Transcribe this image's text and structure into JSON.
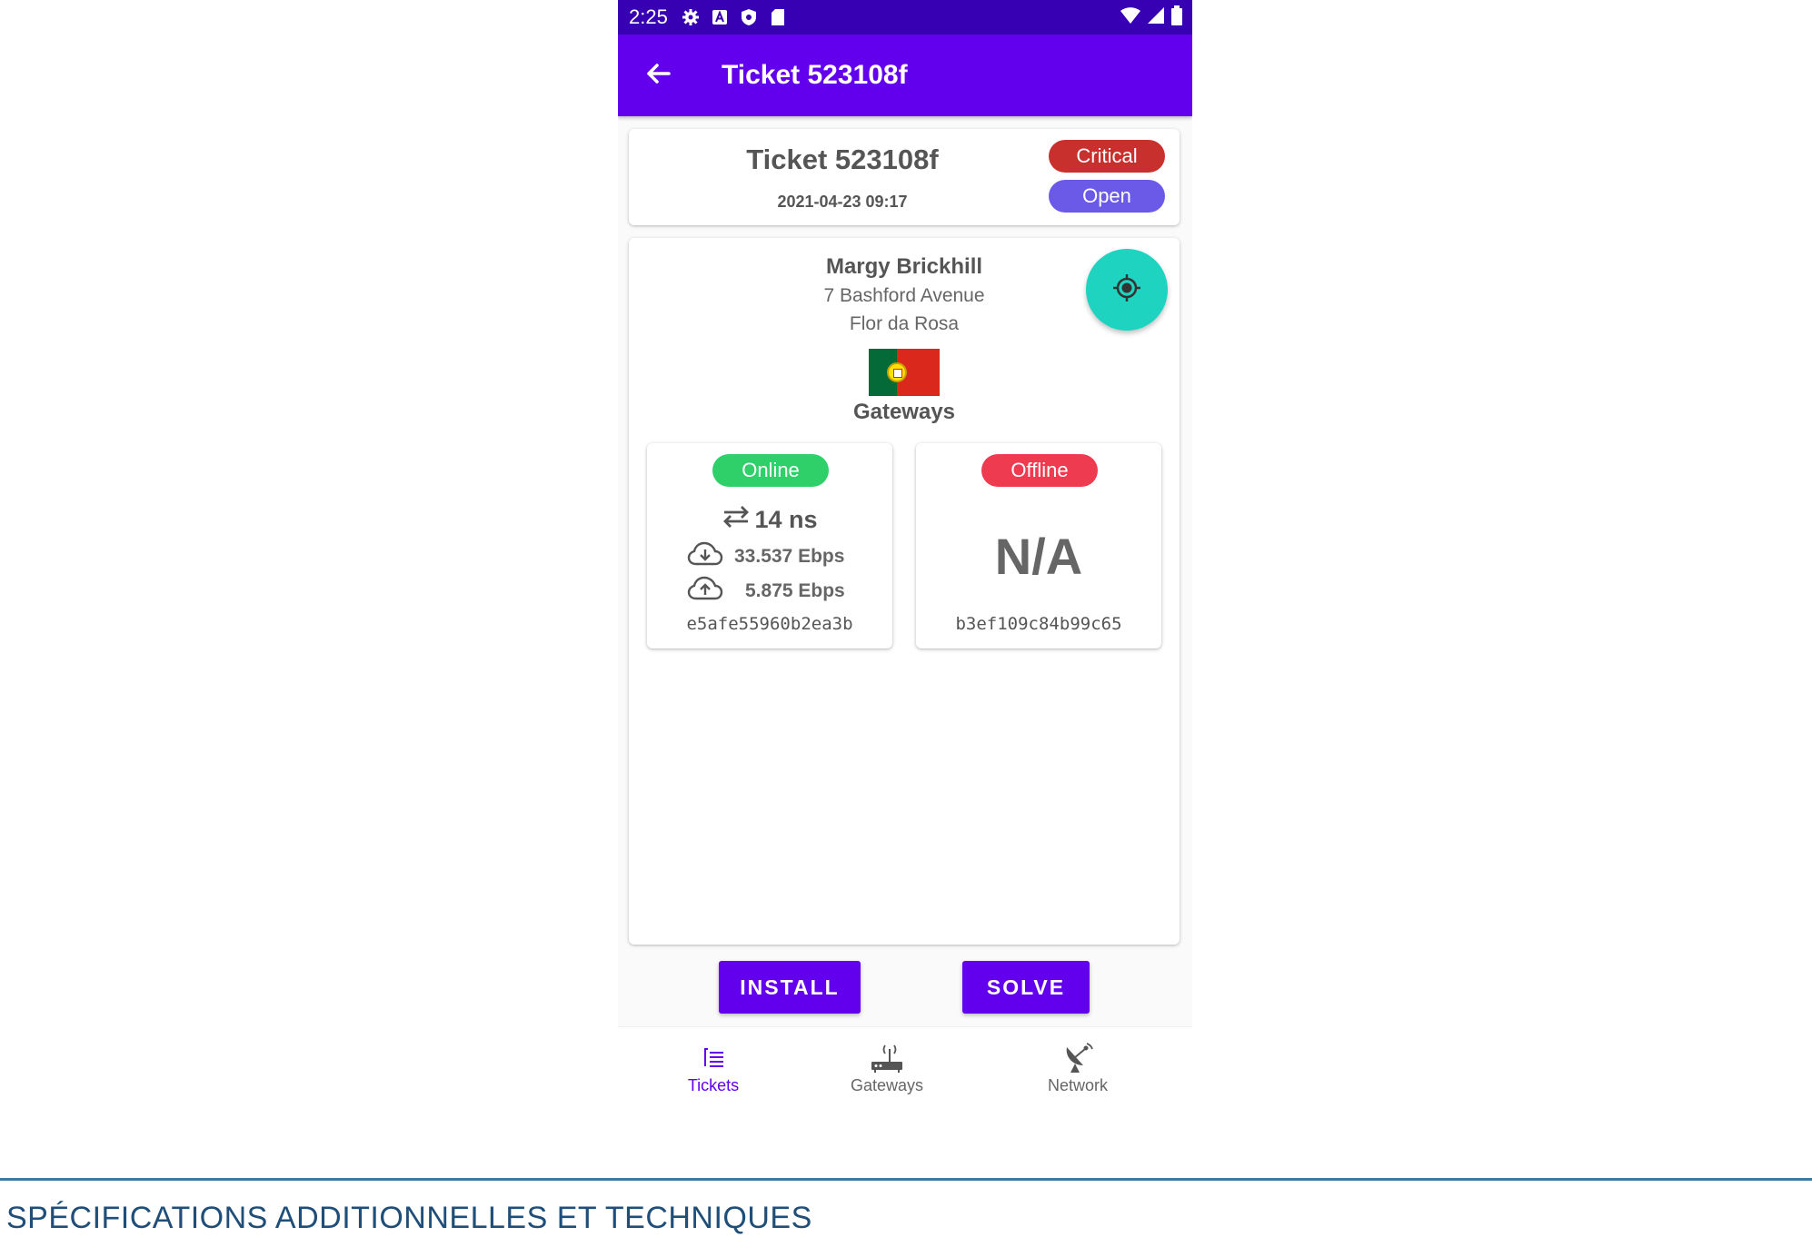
{
  "status_bar": {
    "time": "2:25",
    "icons": [
      "gear-icon",
      "a-icon",
      "shield-icon",
      "sd-card-icon"
    ],
    "right_icons": [
      "wifi-icon",
      "signal-icon",
      "battery-icon"
    ]
  },
  "app_bar": {
    "title": "Ticket 523108f",
    "back_icon": "arrow-back-icon"
  },
  "ticket": {
    "title": "Ticket 523108f",
    "date": "2021-04-23 09:17",
    "priority": "Critical",
    "status": "Open",
    "priority_color": "#c7302c",
    "status_color": "#6b5ae8"
  },
  "customer": {
    "name": "Margy Brickhill",
    "street": "7 Bashford Avenue",
    "city": "Flor da Rosa",
    "flag": "portugal-flag"
  },
  "gateways_heading": "Gateways",
  "gateways": [
    {
      "state": "Online",
      "state_color": "#2fd06a",
      "latency": "14 ns",
      "download": "33.537 Ebps",
      "upload": "5.875 Ebps",
      "id": "e5afe55960b2ea3b"
    },
    {
      "state": "Offline",
      "state_color": "#ee3b50",
      "value": "N/A",
      "id": "b3ef109c84b99c65"
    }
  ],
  "actions": {
    "install": "INSTALL",
    "solve": "SOLVE"
  },
  "bottom_nav": [
    {
      "label": "Tickets",
      "icon": "list-icon",
      "active": true
    },
    {
      "label": "Gateways",
      "icon": "router-icon",
      "active": false
    },
    {
      "label": "Network",
      "icon": "satellite-dish-icon",
      "active": false
    }
  ],
  "footer": "SPÉCIFICATIONS ADDITIONNELLES ET TECHNIQUES",
  "colors": {
    "primary": "#6200ee",
    "primary_dark": "#3700b3",
    "fab": "#1fd3c1"
  }
}
